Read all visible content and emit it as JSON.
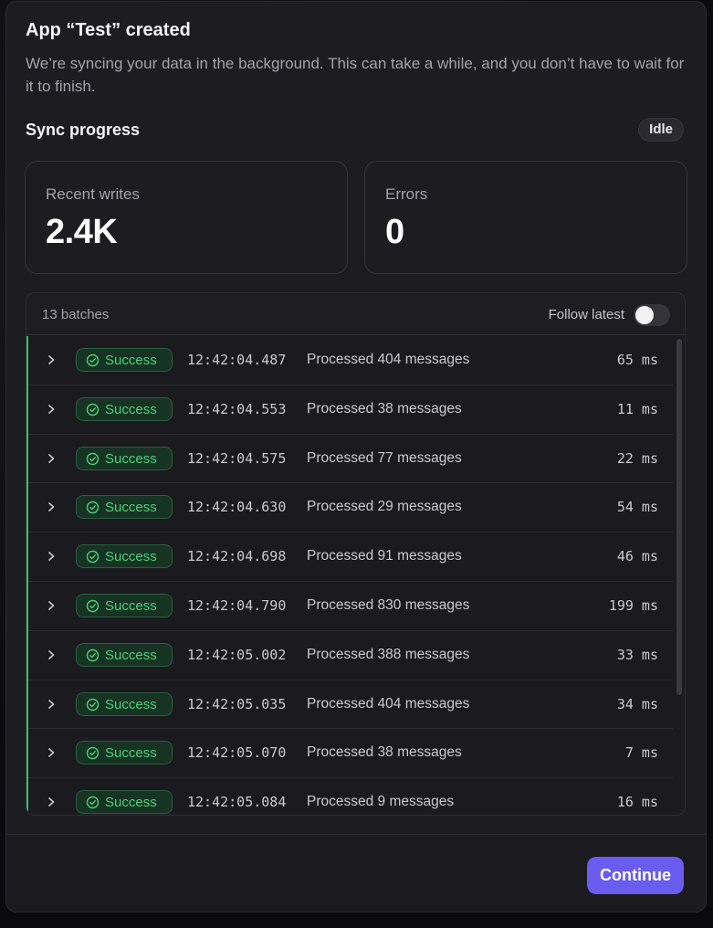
{
  "dialog": {
    "title": "App “Test” created",
    "description": "We’re syncing your data in the background. This can take a while, and you don’t have to wait for it to finish."
  },
  "sync": {
    "section_title": "Sync progress",
    "status_badge": "Idle"
  },
  "stats": {
    "writes_label": "Recent writes",
    "writes_value": "2.4K",
    "errors_label": "Errors",
    "errors_value": "0"
  },
  "batches": {
    "count_label": "13 batches",
    "follow_label": "Follow latest",
    "follow_enabled": false,
    "rows": [
      {
        "status": "Success",
        "time": "12:42:04.487",
        "message": "Processed 404 messages",
        "duration": "65 ms"
      },
      {
        "status": "Success",
        "time": "12:42:04.553",
        "message": "Processed 38 messages",
        "duration": "11 ms"
      },
      {
        "status": "Success",
        "time": "12:42:04.575",
        "message": "Processed 77 messages",
        "duration": "22 ms"
      },
      {
        "status": "Success",
        "time": "12:42:04.630",
        "message": "Processed 29 messages",
        "duration": "54 ms"
      },
      {
        "status": "Success",
        "time": "12:42:04.698",
        "message": "Processed 91 messages",
        "duration": "46 ms"
      },
      {
        "status": "Success",
        "time": "12:42:04.790",
        "message": "Processed 830 messages",
        "duration": "199 ms"
      },
      {
        "status": "Success",
        "time": "12:42:05.002",
        "message": "Processed 388 messages",
        "duration": "33 ms"
      },
      {
        "status": "Success",
        "time": "12:42:05.035",
        "message": "Processed 404 messages",
        "duration": "34 ms"
      },
      {
        "status": "Success",
        "time": "12:42:05.070",
        "message": "Processed 38 messages",
        "duration": "7 ms"
      },
      {
        "status": "Success",
        "time": "12:42:05.084",
        "message": "Processed 9 messages",
        "duration": "16 ms"
      }
    ]
  },
  "footer": {
    "continue_label": "Continue"
  },
  "colors": {
    "success": "#4ad07a",
    "accent": "#6b5cf0"
  },
  "icons": {
    "row_expand": "chevron-right-icon",
    "status": "check-circle-icon"
  }
}
